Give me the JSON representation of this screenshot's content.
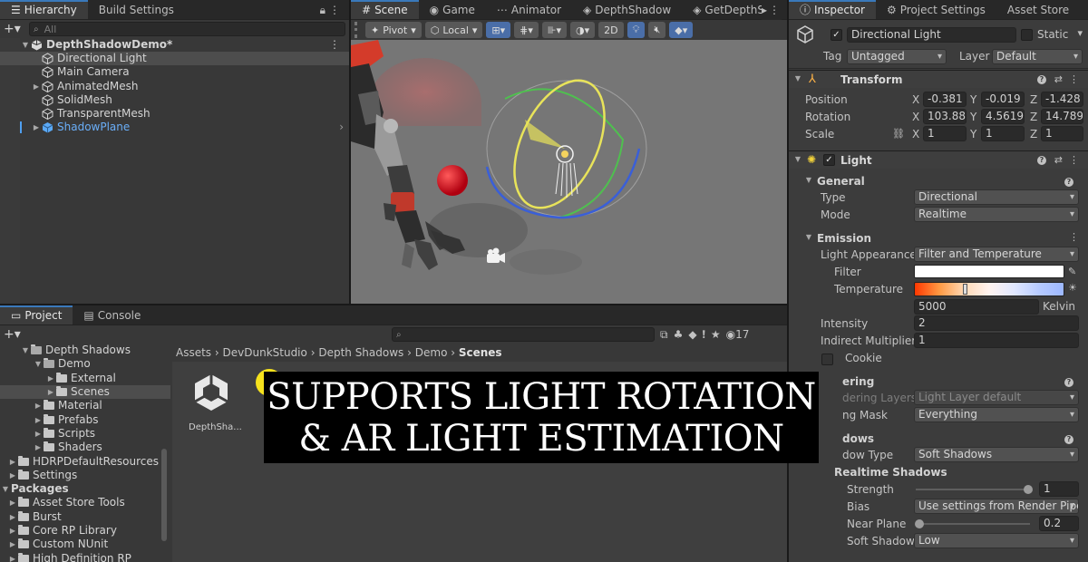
{
  "hierarchy": {
    "tabs": [
      "Hierarchy",
      "Build Settings"
    ],
    "search_placeholder": "All",
    "scene_name": "DepthShadowDemo*",
    "items": [
      "Directional Light",
      "Main Camera",
      "AnimatedMesh",
      "SolidMesh",
      "TransparentMesh",
      "ShadowPlane"
    ]
  },
  "scene": {
    "tabs": [
      "Scene",
      "Game",
      "Animator",
      "DepthShadow",
      "GetDepthSh"
    ],
    "toolbar": {
      "pivot": "Pivot",
      "local": "Local",
      "mode_2d": "2D"
    }
  },
  "project": {
    "tabs": [
      "Project",
      "Console"
    ],
    "tree": [
      {
        "label": "Depth Shadows",
        "depth": 1,
        "open": true
      },
      {
        "label": "Demo",
        "depth": 2,
        "open": true
      },
      {
        "label": "External",
        "depth": 3,
        "open": false
      },
      {
        "label": "Scenes",
        "depth": 3,
        "open": false,
        "selected": true
      },
      {
        "label": "Material",
        "depth": 2,
        "open": false
      },
      {
        "label": "Prefabs",
        "depth": 2,
        "open": false
      },
      {
        "label": "Scripts",
        "depth": 2,
        "open": false
      },
      {
        "label": "Shaders",
        "depth": 2,
        "open": false
      },
      {
        "label": "HDRPDefaultResources",
        "depth": 0,
        "open": false
      },
      {
        "label": "Settings",
        "depth": 0,
        "open": false
      },
      {
        "label": "Packages",
        "depth": -1,
        "open": true,
        "bold": true
      },
      {
        "label": "Asset Store Tools",
        "depth": 0,
        "open": false
      },
      {
        "label": "Burst",
        "depth": 0,
        "open": false
      },
      {
        "label": "Core RP Library",
        "depth": 0,
        "open": false
      },
      {
        "label": "Custom NUnit",
        "depth": 0,
        "open": false
      },
      {
        "label": "High Definition RP",
        "depth": 0,
        "open": false
      }
    ],
    "breadcrumb": [
      "Assets",
      "DevDunkStudio",
      "Depth Shadows",
      "Demo",
      "Scenes"
    ],
    "asset_label": "DepthSha...",
    "hidden_count": "17"
  },
  "inspector": {
    "tabs": [
      "Inspector",
      "Project Settings",
      "Asset Store"
    ],
    "object_name": "Directional Light",
    "static_label": "Static",
    "tag_label": "Tag",
    "tag_value": "Untagged",
    "layer_label": "Layer",
    "layer_value": "Default",
    "transform": {
      "title": "Transform",
      "position": {
        "label": "Position",
        "x": "-0.381",
        "y": "-0.019",
        "z": "-1.428"
      },
      "rotation": {
        "label": "Rotation",
        "x": "103.887",
        "y": "4.56199",
        "z": "14.7899"
      },
      "scale": {
        "label": "Scale",
        "x": "1",
        "y": "1",
        "z": "1"
      }
    },
    "light": {
      "title": "Light",
      "general": "General",
      "type_label": "Type",
      "type_value": "Directional",
      "mode_label": "Mode",
      "mode_value": "Realtime",
      "emission": "Emission",
      "appearance_label": "Light Appearance",
      "appearance_value": "Filter and Temperature",
      "filter_label": "Filter",
      "temperature_label": "Temperature",
      "temperature_value": "5000",
      "kelvin": "Kelvin",
      "intensity_label": "Intensity",
      "intensity_value": "2",
      "indirect_label": "Indirect Multiplier",
      "indirect_value": "1",
      "cookie_label": "Cookie",
      "rendering": "ering",
      "light_layers_label": "dering Layers",
      "light_layers_value": "Light Layer default",
      "culling_label": "ng Mask",
      "culling_value": "Everything",
      "shadows": "dows",
      "shadow_type_label": "dow Type",
      "shadow_type_value": "Soft Shadows",
      "realtime_shadows": "Realtime Shadows",
      "strength_label": "Strength",
      "strength_value": "1",
      "bias_label": "Bias",
      "bias_value": "Use settings from Render Pipe",
      "near_plane_label": "Near Plane",
      "near_plane_value": "0.2",
      "soft_shadow_label": "Soft Shadow",
      "soft_shadow_value": "Low"
    }
  },
  "banner": {
    "line1": "SUPPORTS LIGHT ROTATION",
    "line2": "& AR LIGHT ESTIMATION"
  },
  "colors": {
    "accent": "#3a79bb",
    "selected_text": "#6aaef8",
    "gizmo_yellow": "#e8e35a",
    "gizmo_green": "#4fc04f",
    "gizmo_blue": "#3a5fd8",
    "red_sphere": "#d0121b"
  }
}
